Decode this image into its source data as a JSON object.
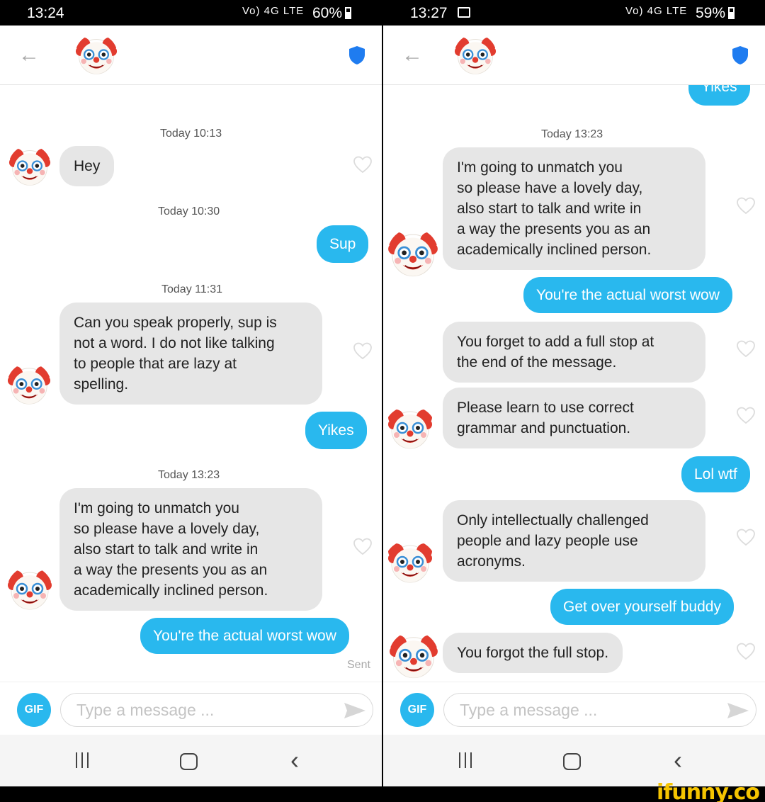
{
  "left": {
    "status": {
      "time": "13:24",
      "signal": "Vo) 4G LTE",
      "battery": "60%",
      "battery_level": 0.6
    },
    "placeholder": "Type a message ...",
    "gif_label": "GIF",
    "sent_label": "Sent",
    "timestamps": [
      "Today 10:13",
      "Today 10:30",
      "Today 11:31",
      "Today 13:23"
    ],
    "messages": {
      "hey": "Hey",
      "sup": "Sup",
      "speak": [
        "Can you speak properly, sup is",
        "not a word. I do not like talking",
        "to people that are lazy at",
        "spelling."
      ],
      "yikes": "Yikes",
      "unmatch": [
        "I'm going to unmatch you",
        "so please have a lovely day,",
        "also start to talk and write in",
        "a way the presents you as an",
        "academically inclined person."
      ],
      "worst": "You're the actual worst wow"
    }
  },
  "right": {
    "status": {
      "time": "13:27",
      "signal": "Vo) 4G LTE",
      "battery": "59%",
      "battery_level": 0.59
    },
    "placeholder": "Type a message ...",
    "gif_label": "GIF",
    "timestamps": [
      "Today 13:23"
    ],
    "messages": {
      "yikes_partial": "Yikes",
      "unmatch": [
        "I'm going to unmatch you",
        "so please have a lovely day,",
        "also start to talk and write in",
        "a way the presents you as an",
        "academically inclined person."
      ],
      "worst": "You're the actual worst wow",
      "full_stop": [
        "You forget to add a full stop at",
        "the end of the message."
      ],
      "grammar": [
        "Please learn to use correct",
        "grammar and punctuation."
      ],
      "lol": "Lol wtf",
      "acronyms": [
        "Only intellectually challenged",
        "people and lazy people use",
        "acronyms."
      ],
      "get_over": "Get over yourself buddy",
      "forgot": "You forgot the full stop."
    }
  },
  "watermark": "ifunny.co",
  "icons": {
    "avatar": "clown-face-icon",
    "shield": "shield-icon",
    "heart": "heart-outline-icon",
    "send": "send-arrow-icon",
    "back": "back-arrow-icon"
  },
  "colors": {
    "accent": "#29b8ee",
    "incoming": "#e6e6e6",
    "shield": "#1f7cf0",
    "watermark": "#f5c400"
  }
}
